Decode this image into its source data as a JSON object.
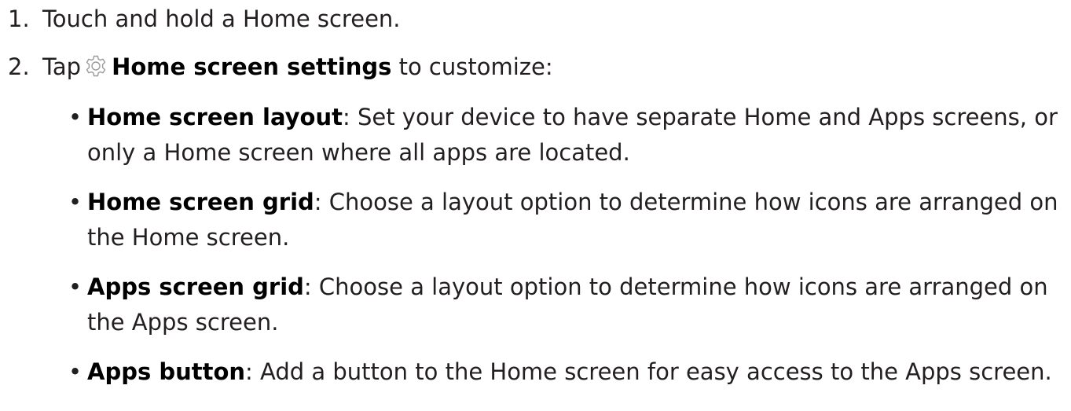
{
  "steps": [
    {
      "number": "1.",
      "text": "Touch and hold a Home screen."
    },
    {
      "number": "2.",
      "prefix": "Tap",
      "icon": "gear-icon",
      "bold": "Home screen settings",
      "suffix": "to customize:"
    }
  ],
  "bullets": [
    {
      "term": "Home screen layout",
      "description": ": Set your device to have separate Home and Apps screens, or only a Home screen where all apps are located."
    },
    {
      "term": "Home screen grid",
      "description": ": Choose a layout option to determine how icons are arranged on the Home screen."
    },
    {
      "term": "Apps screen grid",
      "description": ": Choose a layout option to determine how icons are arranged on the Apps screen."
    },
    {
      "term": "Apps button",
      "description": ": Add a button to the Home screen for easy access to the Apps screen."
    }
  ],
  "bullet_glyph": "•",
  "colors": {
    "text": "#231f20",
    "icon_stroke": "#9a9a9a"
  }
}
